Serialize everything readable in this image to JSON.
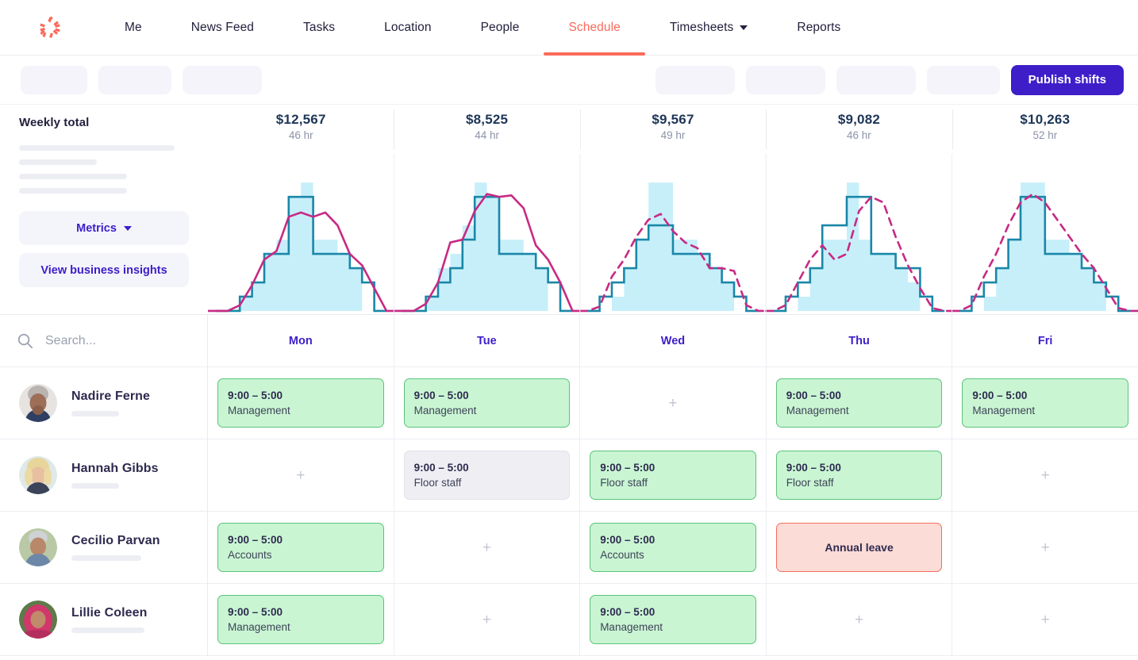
{
  "brand": {
    "logo_icon": "pinwheel-logo",
    "accent": "#fa6a5a",
    "primary": "#3d1ec9"
  },
  "nav": {
    "items": [
      {
        "label": "Me",
        "active": false,
        "dropdown": false
      },
      {
        "label": "News Feed",
        "active": false,
        "dropdown": false
      },
      {
        "label": "Tasks",
        "active": false,
        "dropdown": false
      },
      {
        "label": "Location",
        "active": false,
        "dropdown": false
      },
      {
        "label": "People",
        "active": false,
        "dropdown": false
      },
      {
        "label": "Schedule",
        "active": true,
        "dropdown": false
      },
      {
        "label": "Timesheets",
        "active": false,
        "dropdown": true
      },
      {
        "label": "Reports",
        "active": false,
        "dropdown": false
      }
    ]
  },
  "toolbar": {
    "publish_label": "Publish shifts",
    "left_placeholders": [
      84,
      92,
      100
    ],
    "right_placeholders": [
      100,
      100,
      100,
      92
    ]
  },
  "metrics_panel": {
    "title": "Weekly total",
    "placeholder_bars": [
      196,
      98,
      136,
      136
    ],
    "metrics_label": "Metrics",
    "insights_label": "View business insights",
    "caret_icon": "chevron-down-icon"
  },
  "search": {
    "placeholder": "Search...",
    "value": "",
    "icon": "search-icon"
  },
  "days": [
    "Mon",
    "Tue",
    "Wed",
    "Thu",
    "Fri"
  ],
  "weekly_totals": [
    {
      "day": "Mon",
      "amount": "$12,567",
      "hours": "46 hr"
    },
    {
      "day": "Tue",
      "amount": "$8,525",
      "hours": "44 hr"
    },
    {
      "day": "Wed",
      "amount": "$9,567",
      "hours": "49 hr"
    },
    {
      "day": "Thu",
      "amount": "$9,082",
      "hours": "46 hr"
    },
    {
      "day": "Fri",
      "amount": "$10,263",
      "hours": "52 hr"
    }
  ],
  "chart_data": {
    "type": "area",
    "title": "Daily demand vs scheduled labour",
    "xlabel": "",
    "ylabel": "",
    "grid": false,
    "legend": "none",
    "ylim": [
      0,
      10
    ],
    "colors": {
      "demand_fill": "#c7effa",
      "scheduled_line": "#1a87a8",
      "forecast_line": "#c72a84"
    },
    "series_notes": "Per-day panels. demand = light blue filled step bars; scheduled = teal step line; forecast = magenta line (solid for Mon/Tue = actual, dashed for Wed/Thu/Fri = projected).",
    "panels": [
      {
        "day": "Mon",
        "forecast_style": "solid",
        "demand": [
          0,
          0,
          1,
          2,
          4,
          5,
          8,
          9,
          5,
          5,
          4,
          3,
          0,
          0
        ],
        "scheduled": [
          0,
          0,
          1,
          2,
          4,
          4,
          8,
          8,
          4,
          4,
          4,
          3,
          2,
          0
        ],
        "forecast": [
          0,
          0,
          0.4,
          1.8,
          3.6,
          4.2,
          6.6,
          6.9,
          6.6,
          6.9,
          6.0,
          4.0,
          3.2,
          1.6,
          0
        ]
      },
      {
        "day": "Tue",
        "forecast_style": "solid",
        "demand": [
          0,
          0,
          1,
          3,
          4,
          6,
          9,
          8,
          5,
          5,
          4,
          3,
          0,
          0
        ],
        "scheduled": [
          0,
          0,
          1,
          2,
          3,
          5,
          8,
          8,
          4,
          4,
          4,
          3,
          2,
          0
        ],
        "forecast": [
          0,
          0,
          0.5,
          2.0,
          4.8,
          5.0,
          7.0,
          8.2,
          8.0,
          8.1,
          7.2,
          4.6,
          3.6,
          2.0,
          0
        ]
      },
      {
        "day": "Wed",
        "forecast_style": "dashed",
        "demand": [
          0,
          0,
          1,
          3,
          5,
          9,
          9,
          5,
          5,
          4,
          3,
          2,
          0,
          0
        ],
        "scheduled": [
          0,
          1,
          2,
          3,
          5,
          6,
          6,
          4,
          4,
          4,
          3,
          2,
          1,
          0
        ],
        "forecast": [
          0,
          0.3,
          2.4,
          3.6,
          5.2,
          6.4,
          6.8,
          5.6,
          4.8,
          4.4,
          3.0,
          3.0,
          2.8,
          0.4,
          0
        ]
      },
      {
        "day": "Thu",
        "forecast_style": "dashed",
        "demand": [
          0,
          0,
          1,
          3,
          5,
          5,
          9,
          5,
          4,
          4,
          3,
          2,
          0,
          0
        ],
        "scheduled": [
          0,
          1,
          2,
          3,
          6,
          6,
          8,
          8,
          4,
          4,
          3,
          3,
          1,
          0
        ],
        "forecast": [
          0,
          0.4,
          2.0,
          3.6,
          4.6,
          3.6,
          4.0,
          7.0,
          8.0,
          7.6,
          5.2,
          3.2,
          1.6,
          0.2,
          0
        ]
      },
      {
        "day": "Fri",
        "forecast_style": "dashed",
        "demand": [
          0,
          0,
          1,
          3,
          5,
          9,
          9,
          5,
          5,
          4,
          3,
          2,
          0,
          0
        ],
        "scheduled": [
          0,
          1,
          2,
          3,
          5,
          8,
          8,
          4,
          4,
          4,
          3,
          2,
          1,
          0
        ],
        "forecast": [
          0,
          0.4,
          2.4,
          4.0,
          6.0,
          7.6,
          8.2,
          7.6,
          6.4,
          5.2,
          4.0,
          3.0,
          1.6,
          0.2,
          0
        ]
      }
    ]
  },
  "employees": [
    {
      "name": "Nadire Ferne",
      "avatar": "avatar-nadire-ferne",
      "sub_width": 60,
      "shifts": [
        {
          "type": "published",
          "time": "9:00 – 5:00",
          "role": "Management"
        },
        {
          "type": "published",
          "time": "9:00 – 5:00",
          "role": "Management"
        },
        {
          "type": "empty",
          "add_label": "+"
        },
        {
          "type": "published",
          "time": "9:00 – 5:00",
          "role": "Management"
        },
        {
          "type": "published",
          "time": "9:00 – 5:00",
          "role": "Management"
        }
      ]
    },
    {
      "name": "Hannah Gibbs",
      "avatar": "avatar-hannah-gibbs",
      "sub_width": 60,
      "shifts": [
        {
          "type": "empty",
          "add_label": "+"
        },
        {
          "type": "draft",
          "time": "9:00 – 5:00",
          "role": "Floor staff"
        },
        {
          "type": "published",
          "time": "9:00 – 5:00",
          "role": "Floor staff"
        },
        {
          "type": "published",
          "time": "9:00 – 5:00",
          "role": "Floor staff"
        },
        {
          "type": "empty",
          "add_label": "+"
        }
      ]
    },
    {
      "name": "Cecilio Parvan",
      "avatar": "avatar-cecilio-parvan",
      "sub_width": 88,
      "shifts": [
        {
          "type": "published",
          "time": "9:00 – 5:00",
          "role": "Accounts"
        },
        {
          "type": "empty",
          "add_label": "+"
        },
        {
          "type": "published",
          "time": "9:00 – 5:00",
          "role": "Accounts"
        },
        {
          "type": "leave",
          "label": "Annual leave"
        },
        {
          "type": "empty",
          "add_label": "+"
        }
      ]
    },
    {
      "name": "Lillie Coleen",
      "avatar": "avatar-lillie-coleen",
      "sub_width": 92,
      "shifts": [
        {
          "type": "published",
          "time": "9:00 – 5:00",
          "role": "Management"
        },
        {
          "type": "empty",
          "add_label": "+"
        },
        {
          "type": "published",
          "time": "9:00 – 5:00",
          "role": "Management"
        },
        {
          "type": "empty",
          "add_label": "+"
        },
        {
          "type": "empty",
          "add_label": "+"
        }
      ]
    }
  ]
}
